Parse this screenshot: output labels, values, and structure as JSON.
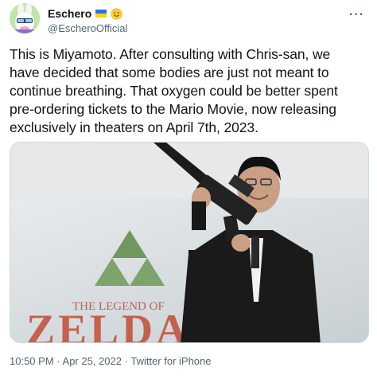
{
  "author": {
    "display_name": "Eschero",
    "handle": "@EscheroOfficial",
    "flag_colors": [
      "#2f6fe0",
      "#ffd500"
    ],
    "avatar_icon": "rabbit-avatar-icon"
  },
  "menu_icon": "more-horizontal-icon",
  "menu_glyph": "···",
  "tweet_text": "This is Miyamoto. After consulting with Chris-san, we\nhave decided that some bodies are just not meant to\ncontinue breathing. That oxygen could be better spent\npre-ordering tickets to the Mario Movie, now releasing\nexclusively in theaters on April 7th, 2023.",
  "media": {
    "logo_text": "THE LEGEND OF",
    "logo_title": "ZELDA"
  },
  "meta": {
    "time": "10:50 PM",
    "date": "Apr 25, 2022",
    "separator": "·",
    "source": "Twitter for iPhone"
  }
}
